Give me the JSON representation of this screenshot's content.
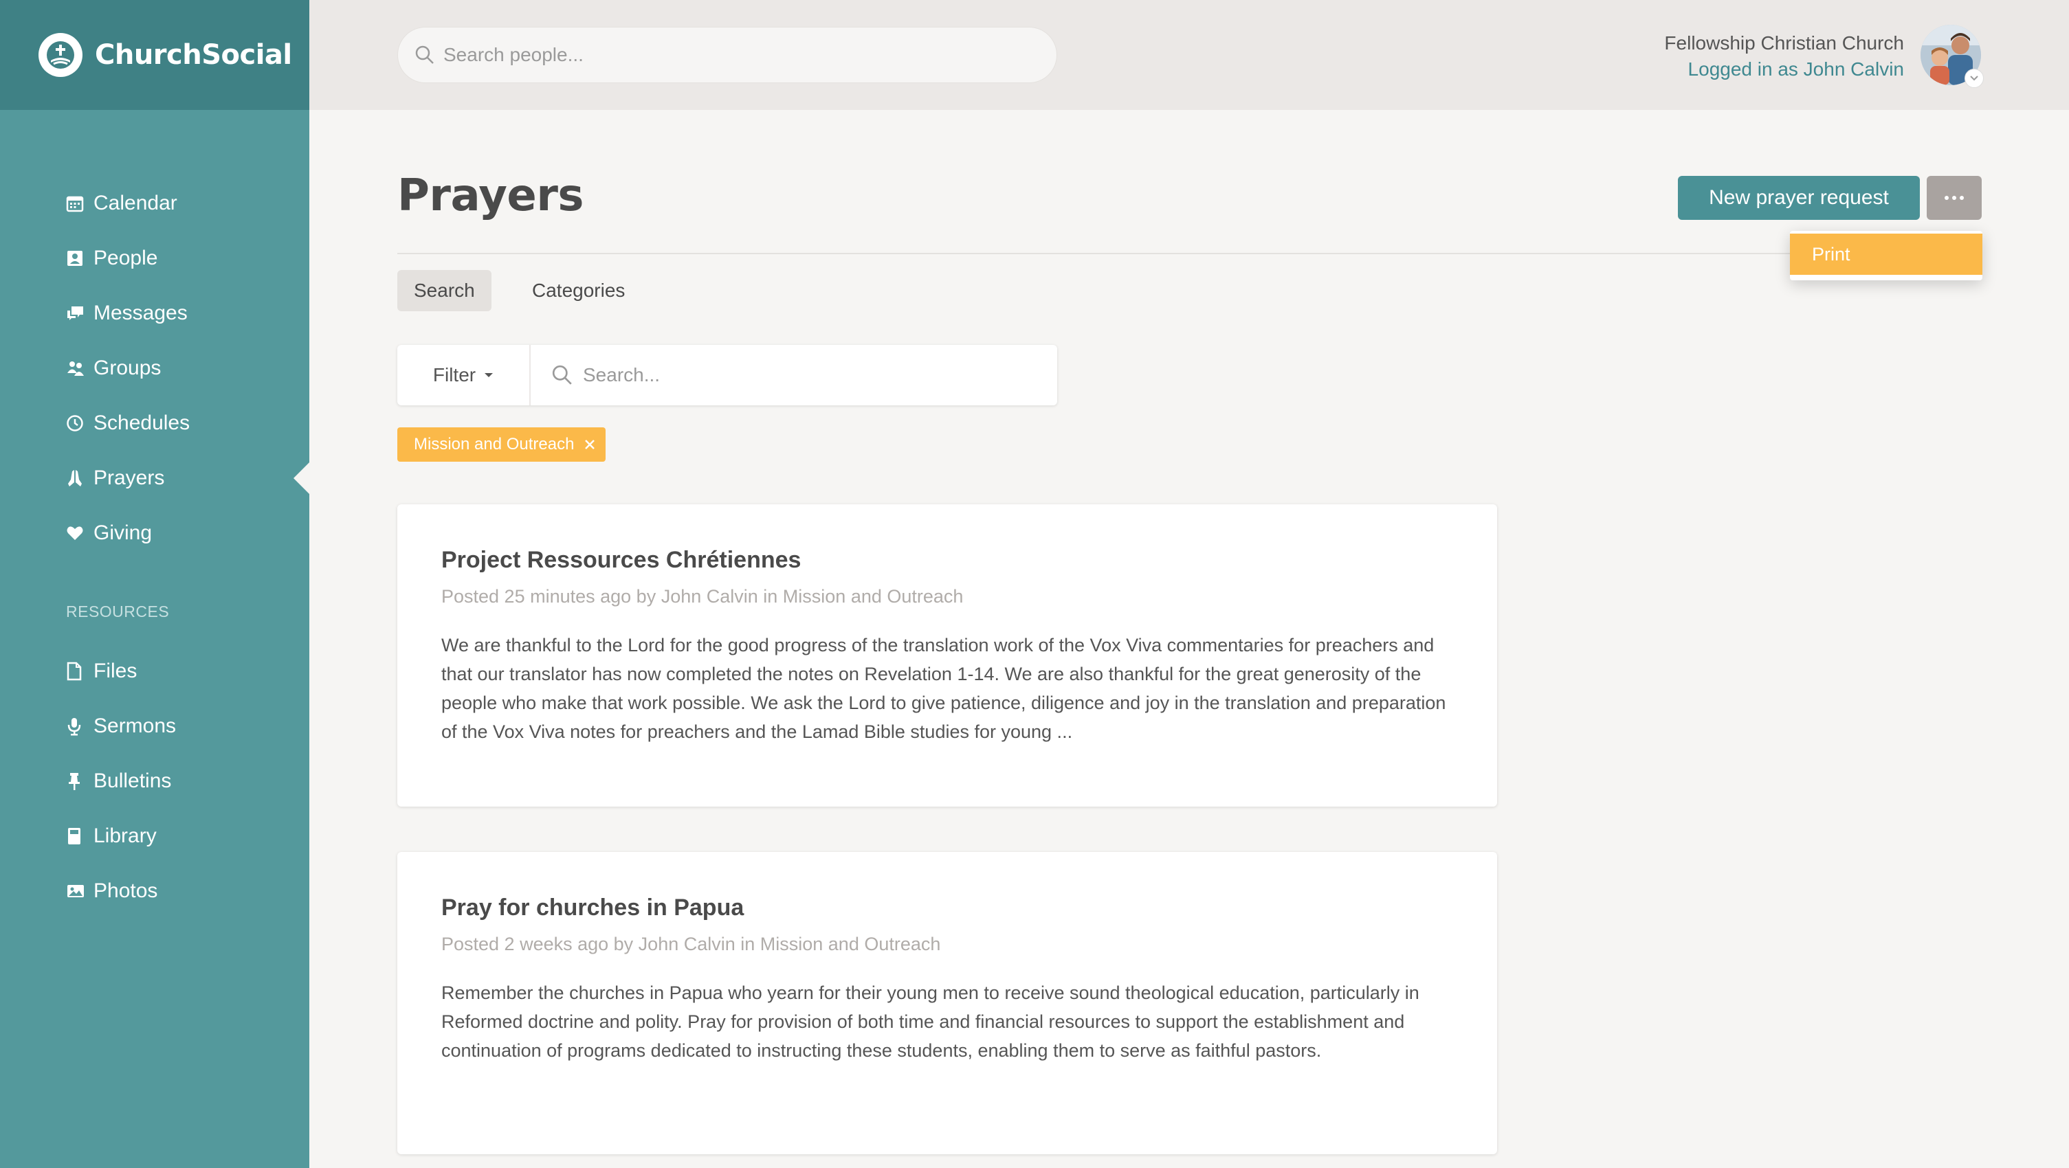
{
  "app": {
    "brand": "ChurchSocial"
  },
  "sidebar": {
    "items": [
      {
        "label": "Calendar",
        "icon": "calendar-icon"
      },
      {
        "label": "People",
        "icon": "person-card-icon"
      },
      {
        "label": "Messages",
        "icon": "chat-bubbles-icon"
      },
      {
        "label": "Groups",
        "icon": "group-icon"
      },
      {
        "label": "Schedules",
        "icon": "clock-icon"
      },
      {
        "label": "Prayers",
        "icon": "praying-hands-icon",
        "active": true
      },
      {
        "label": "Giving",
        "icon": "heart-icon"
      }
    ],
    "resources_heading": "RESOURCES",
    "resources": [
      {
        "label": "Files",
        "icon": "file-icon"
      },
      {
        "label": "Sermons",
        "icon": "microphone-icon"
      },
      {
        "label": "Bulletins",
        "icon": "pushpin-icon"
      },
      {
        "label": "Library",
        "icon": "book-icon"
      },
      {
        "label": "Photos",
        "icon": "image-icon"
      }
    ]
  },
  "header": {
    "search_placeholder": "Search people...",
    "org_name": "Fellowship Christian Church",
    "logged_in": "Logged in as John Calvin"
  },
  "main": {
    "title": "Prayers",
    "new_button": "New prayer request",
    "more_menu": {
      "items": [
        "Print"
      ]
    },
    "tabs": [
      {
        "label": "Search",
        "active": true
      },
      {
        "label": "Categories",
        "active": false
      }
    ],
    "filter_label": "Filter",
    "search_placeholder": "Search...",
    "active_filter": "Mission and Outreach",
    "posts": [
      {
        "title": "Project Ressources Chrétiennes",
        "meta": "Posted 25 minutes ago by John Calvin in Mission and Outreach",
        "body": "We are thankful to the Lord for the good progress of the translation work of the Vox Viva commentaries for preachers and that our translator has now completed the notes on Revelation 1-14. We are also thankful for the great generosity of the people who make that work possible. We ask the Lord to give patience, diligence and joy in the translation and preparation of the Vox Viva notes for preachers and the Lamad Bible studies for young ..."
      },
      {
        "title": "Pray for churches in Papua",
        "meta": "Posted 2 weeks ago by John Calvin in Mission and Outreach",
        "body": "Remember the churches in Papua who yearn for their young men to receive sound theological education, particularly in Reformed doctrine and polity. Pray for provision of both time and financial resources to support the establishment and continuation of programs dedicated to instructing these students, enabling them to serve as faithful pastors."
      }
    ]
  },
  "colors": {
    "sidebar": "#54999c",
    "brand_bar": "#3f8185",
    "primary_button": "#4a9196",
    "accent": "#fbb949",
    "link": "#3f8890"
  }
}
